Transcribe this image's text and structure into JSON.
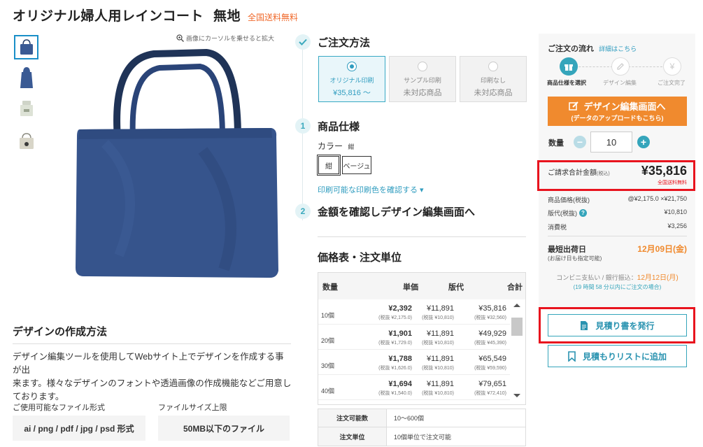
{
  "header": {
    "title": "オリジナル婦人用レインコート",
    "variant": "無地",
    "free_shipping": "全国送料無料"
  },
  "gallery": {
    "zoom_hint": "画像にカーソルを乗せると拡大"
  },
  "design": {
    "heading": "デザインの作成方法",
    "desc_lines": [
      "デザイン編集ツールを使用してWebサイト上でデザインを作成する事が出",
      "来ます。様々なデザインのフォントや透過画像の作成機能などご用意し",
      "ております。"
    ],
    "file_format_label": "ご使用可能なファイル形式",
    "file_size_label": "ファイルサイズ上限",
    "file_format_value": "ai / png / pdf / jpg / psd 形式",
    "file_size_value": "50MB以下のファイル"
  },
  "order": {
    "method_heading": "ご注文方法",
    "methods": [
      {
        "line1": "オリジナル印刷",
        "line2": "¥35,816 〜"
      },
      {
        "line1": "サンプル印刷",
        "line2": "未対応商品"
      },
      {
        "line1": "印刷なし",
        "line2": "未対応商品"
      }
    ],
    "step1_num": "1",
    "step1_heading": "商品仕様",
    "color_label": "カラー",
    "color_selected": "紺",
    "color_options": [
      "紺",
      "ベージュ"
    ],
    "print_color_link": "印刷可能な印刷色を確認する ▾",
    "step2_num": "2",
    "step2_heading": "金額を確認しデザイン編集画面へ"
  },
  "price_table": {
    "heading": "価格表・注文単位",
    "headers": [
      "数量",
      "単価",
      "版代",
      "合計"
    ],
    "rows": [
      {
        "qty": "10個",
        "unit": "¥2,392",
        "unit_ex": "(税抜 ¥2,175.0)",
        "plate": "¥11,891",
        "plate_ex": "(税抜 ¥10,810)",
        "total": "¥35,816",
        "total_ex": "(税抜 ¥32,560)"
      },
      {
        "qty": "20個",
        "unit": "¥1,901",
        "unit_ex": "(税抜 ¥1,729.0)",
        "plate": "¥11,891",
        "plate_ex": "(税抜 ¥10,810)",
        "total": "¥49,929",
        "total_ex": "(税抜 ¥45,390)"
      },
      {
        "qty": "30個",
        "unit": "¥1,788",
        "unit_ex": "(税抜 ¥1,626.0)",
        "plate": "¥11,891",
        "plate_ex": "(税抜 ¥10,810)",
        "total": "¥65,549",
        "total_ex": "(税抜 ¥59,590)"
      },
      {
        "qty": "40個",
        "unit": "¥1,694",
        "unit_ex": "(税抜 ¥1,540.0)",
        "plate": "¥11,891",
        "plate_ex": "(税抜 ¥10,810)",
        "total": "¥79,651",
        "total_ex": "(税抜 ¥72,410)"
      }
    ],
    "info": [
      {
        "k": "注文可能数",
        "v": "10〜600個"
      },
      {
        "k": "注文単位",
        "v": "10個単位で注文可能"
      }
    ]
  },
  "side": {
    "flow_title": "ご注文の流れ",
    "flow_link": "詳細はこちら",
    "flow_steps": [
      "商品仕様を選択",
      "デザイン編集",
      "ご注文完了"
    ],
    "design_btn_main": "デザイン編集画面へ",
    "design_btn_sub": "(データのアップロードもこちら)",
    "qty_label": "数量",
    "qty_value": "10",
    "total_label": "ご請求合計金額",
    "total_tax": "(税込)",
    "total_value": "¥35,816",
    "total_free": "全国送料無料",
    "lines": [
      {
        "k": "商品価格(税抜)",
        "v": "@¥2,175.0 ×¥21,750"
      },
      {
        "k": "版代(税抜)",
        "v": "¥10,810"
      },
      {
        "k": "消費税",
        "v": "¥3,256"
      }
    ],
    "ship_label": "最短出荷日",
    "ship_sub": "(お届け日も指定可能)",
    "ship_date": "12月09日(金)",
    "conv_label": "コンビニ支払い / 銀行振込：",
    "conv_date": "12月12日(月)",
    "deadline": "(19 時間 58 分以内にご注文の場合)",
    "quote_btn": "見積り書を発行",
    "list_btn": "見積もりリストに追加"
  },
  "colors": {
    "accent": "#35a5bb",
    "orange": "#f08a2e",
    "red": "#e8141e",
    "navy": "#2d4a7c"
  }
}
